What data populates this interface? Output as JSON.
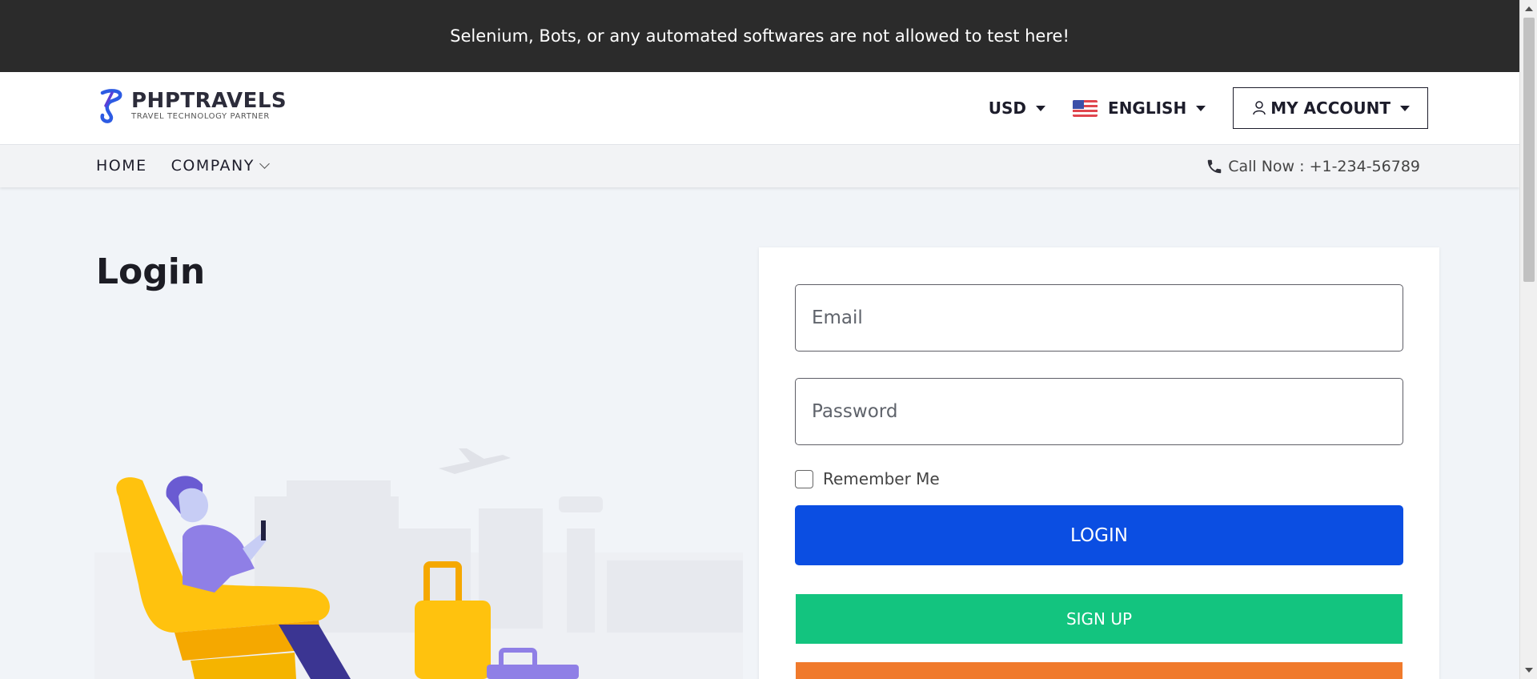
{
  "banner": {
    "text": "Selenium, Bots, or any automated softwares are not allowed to test here!"
  },
  "header": {
    "logo_name": "PHPTRAVELS",
    "logo_tagline": "TRAVEL TECHNOLOGY PARTNER",
    "currency": "USD",
    "language": "ENGLISH",
    "account": "MY ACCOUNT"
  },
  "nav": {
    "items": [
      {
        "label": "HOME"
      },
      {
        "label": "COMPANY"
      }
    ],
    "phone": "Call Now : +1-234-56789"
  },
  "main": {
    "title": "Login"
  },
  "login_form": {
    "email_placeholder": "Email",
    "password_placeholder": "Password",
    "remember_label": "Remember Me",
    "login_button": "LOGIN",
    "signup_button": "SIGN UP"
  },
  "colors": {
    "banner_bg": "#2b2b2b",
    "login_button": "#0b4ee2",
    "signup_button": "#13c47f",
    "forgot_button": "#f07a2c"
  }
}
